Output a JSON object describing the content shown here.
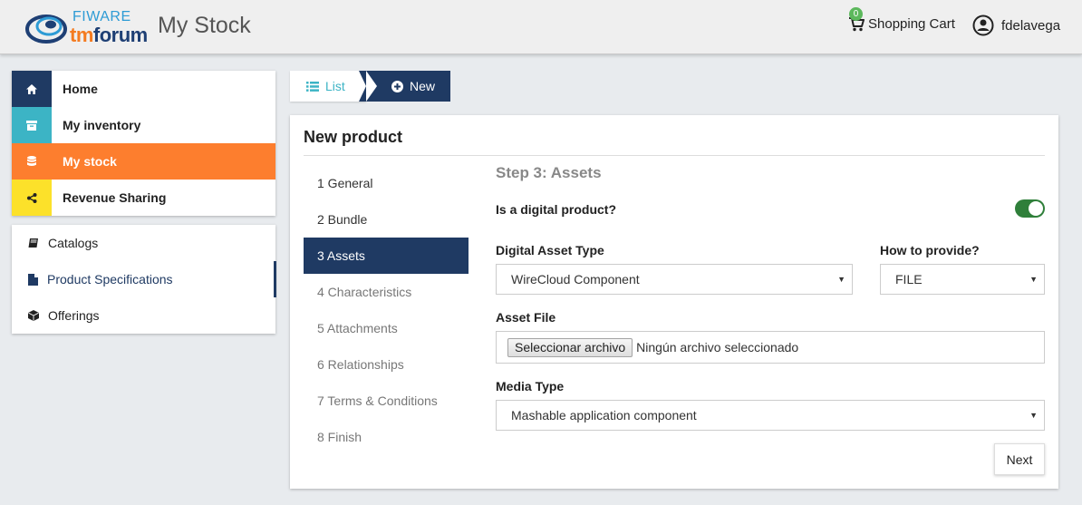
{
  "header": {
    "logo_fiware": "FIWARE",
    "logo_tm": "tm",
    "logo_forum": "forum",
    "app_title": "My Stock",
    "cart_count": "0",
    "cart_label": "Shopping Cart",
    "username": "fdelavega"
  },
  "nav": {
    "main": [
      {
        "label": "Home",
        "icon": "home-icon",
        "color": "#1f3a63"
      },
      {
        "label": "My inventory",
        "icon": "archive-icon",
        "color": "#3cb4c5"
      },
      {
        "label": "My stock",
        "icon": "database-icon",
        "color": "#fd7e2e"
      },
      {
        "label": "Revenue Sharing",
        "icon": "share-icon",
        "color": "#fce12a"
      }
    ],
    "sub": [
      {
        "label": "Catalogs",
        "icon": "book-icon"
      },
      {
        "label": "Product Specifications",
        "icon": "file-icon"
      },
      {
        "label": "Offerings",
        "icon": "cube-icon"
      }
    ]
  },
  "crumbs": {
    "list": "List",
    "new": "New"
  },
  "panel": {
    "title": "New product",
    "steps": [
      "1 General",
      "2 Bundle",
      "3 Assets",
      "4 Characteristics",
      "5 Attachments",
      "6 Relationships",
      "7 Terms & Conditions",
      "8 Finish"
    ],
    "step_title": "Step 3: Assets",
    "digital_label": "Is a digital product?",
    "digital_value": true,
    "asset_type_label": "Digital Asset Type",
    "asset_type_value": "WireCloud Component",
    "provide_label": "How to provide?",
    "provide_value": "FILE",
    "asset_file_label": "Asset File",
    "file_button": "Seleccionar archivo",
    "file_status": "Ningún archivo seleccionado",
    "media_type_label": "Media Type",
    "media_type_value": "Mashable application component",
    "next_label": "Next"
  },
  "colors": {
    "navy": "#1f3a63",
    "teal": "#3cb4c5",
    "orange": "#fd7e2e",
    "yellow": "#fce12a",
    "toggle_on": "#2f7f3a"
  }
}
